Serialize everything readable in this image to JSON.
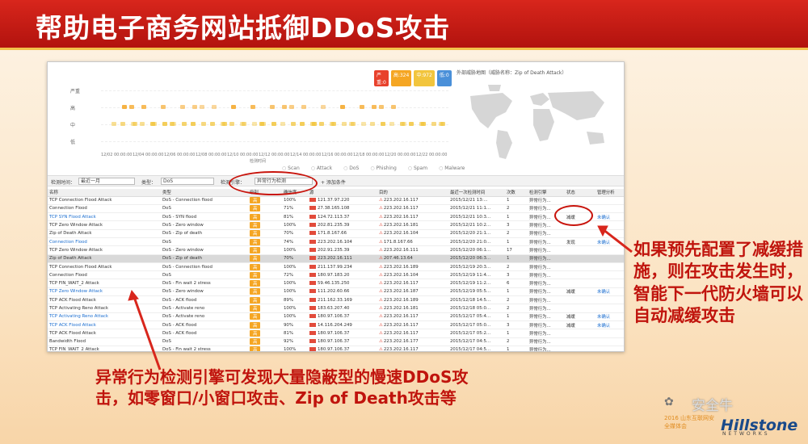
{
  "slide": {
    "title": "帮助电子商务网站抵御DDoS攻击",
    "callout_right": "如果预先配置了减缓措施，则在攻击发生时，智能下一代防火墙可以自动减缓攻击",
    "callout_left": "异常行为检测引擎可发现大量隐蔽型的慢速DDoS攻击，如零窗口/小窗口攻击、Zip of Death攻击等"
  },
  "chart": {
    "legend": [
      "严重:0",
      "高:324",
      "中:972",
      "低:0"
    ],
    "legend_colors": [
      "#e8412c",
      "#f5a623",
      "#f2c53d",
      "#4a90d9"
    ],
    "y_labels": [
      "严重",
      "高",
      "中",
      "低"
    ],
    "x_ticks": [
      "12/02 00:00:00",
      "12/04 00:00:00",
      "12/06 00:00:00",
      "12/08 00:00:00",
      "12/10 00:00:00",
      "12/12 00:00:00",
      "12/14 00:00:00",
      "12/16 00:00:00",
      "12/18 00:00:00",
      "12/20 00:00:00",
      "12/22 00:00:00"
    ],
    "x_label": "检测时间"
  },
  "map": {
    "title": "外部威胁地图（威胁名称：Zip of Death Attack）"
  },
  "categories": [
    "Scan",
    "Attack",
    "DoS",
    "Phishing",
    "Spam",
    "Malware"
  ],
  "filters": {
    "time_label": "检测时间：",
    "time_value": "最近一月",
    "type_label": "类型：",
    "type_value": "DoS",
    "engine_label": "检测引擎：",
    "engine_value": "异常行为检测",
    "add_label": "+  添加条件"
  },
  "table": {
    "headers": [
      "名称",
      "类型",
      "级别",
      "确信度",
      "源",
      "目的",
      "最近一次检测时间",
      "次数",
      "检测引擎",
      "状态",
      "管理分析"
    ],
    "rows": [
      {
        "name": "TCP Connection Flood Attack",
        "type": "DoS - Connection flood",
        "sev": "高",
        "conf": "100%",
        "src": "121.37.97.220",
        "dst": "223.202.16.117",
        "time": "2015/12/21 13:...",
        "count": "1",
        "engine": "异常行为...",
        "status": "",
        "action": ""
      },
      {
        "name": "Connection Flood",
        "type": "DoS",
        "sev": "高",
        "conf": "71%",
        "src": "27.38.165.108",
        "dst": "223.202.16.117",
        "time": "2015/12/21 11:1...",
        "count": "2",
        "engine": "异常行为...",
        "status": "",
        "action": ""
      },
      {
        "name": "TCP SYN Flood Attack",
        "type": "DoS - SYN flood",
        "sev": "高",
        "conf": "81%",
        "src": "124.72.113.37",
        "dst": "223.202.16.117",
        "time": "2015/12/21 10:3...",
        "count": "1",
        "engine": "异常行为...",
        "status": "减缓",
        "action": "未确认"
      },
      {
        "name": "TCP Zero Window Attack",
        "type": "DoS - Zero window",
        "sev": "高",
        "conf": "100%",
        "src": "202.81.235.39",
        "dst": "223.202.16.181",
        "time": "2015/12/21 10:2...",
        "count": "3",
        "engine": "异常行为...",
        "status": "",
        "action": ""
      },
      {
        "name": "Zip of Death Attack",
        "type": "DoS - Zip of death",
        "sev": "高",
        "conf": "70%",
        "src": "171.8.167.66",
        "dst": "223.202.16.104",
        "time": "2015/12/20 21:1...",
        "count": "2",
        "engine": "异常行为...",
        "status": "",
        "action": ""
      },
      {
        "name": "Connection Flood",
        "type": "DoS",
        "sev": "高",
        "conf": "74%",
        "src": "223.202.16.104",
        "dst": "171.8.167.66",
        "time": "2015/12/20 21:0...",
        "count": "1",
        "engine": "异常行为...",
        "status": "发现",
        "action": "未确认"
      },
      {
        "name": "TCP Zero Window Attack",
        "type": "DoS - Zero window",
        "sev": "高",
        "conf": "100%",
        "src": "202.91.235.39",
        "dst": "223.202.16.111",
        "time": "2015/12/20 06:1...",
        "count": "17",
        "engine": "异常行为...",
        "status": "",
        "action": ""
      },
      {
        "name": "Zip of Death Attack",
        "type": "DoS - Zip of death",
        "sev": "高",
        "conf": "70%",
        "src": "223.202.16.111",
        "dst": "207.46.13.64",
        "time": "2015/12/20 06:3...",
        "count": "1",
        "engine": "异常行为...",
        "status": "",
        "action": ""
      },
      {
        "name": "TCP Connection Flood Attack",
        "type": "DoS - Connection flood",
        "sev": "高",
        "conf": "100%",
        "src": "211.137.99.234",
        "dst": "223.202.16.189",
        "time": "2015/12/19 20:3...",
        "count": "2",
        "engine": "异常行为...",
        "status": "",
        "action": ""
      },
      {
        "name": "Connection Flood",
        "type": "DoS",
        "sev": "高",
        "conf": "72%",
        "src": "180.97.183.20",
        "dst": "223.202.16.104",
        "time": "2015/12/19 11:4...",
        "count": "3",
        "engine": "异常行为...",
        "status": "",
        "action": ""
      },
      {
        "name": "TCP FIN_WAIT_2 Attack",
        "type": "DoS - Fin wait 2 stress",
        "sev": "高",
        "conf": "100%",
        "src": "59.46.135.250",
        "dst": "223.202.16.117",
        "time": "2015/12/19 11:2...",
        "count": "6",
        "engine": "异常行为...",
        "status": "",
        "action": ""
      },
      {
        "name": "TCP Zero Window Attack",
        "type": "DoS - Zero window",
        "sev": "高",
        "conf": "100%",
        "src": "111.202.60.66",
        "dst": "223.202.16.187",
        "time": "2015/12/19 05:5...",
        "count": "1",
        "engine": "异常行为...",
        "status": "减缓",
        "action": "未确认"
      },
      {
        "name": "TCP ACK Flood Attack",
        "type": "DoS - ACK flood",
        "sev": "高",
        "conf": "89%",
        "src": "211.162.33.169",
        "dst": "223.202.16.189",
        "time": "2015/12/18 14:5...",
        "count": "2",
        "engine": "异常行为...",
        "status": "",
        "action": ""
      },
      {
        "name": "TCP Activating Reno Attack",
        "type": "DoS - Activate reno",
        "sev": "高",
        "conf": "100%",
        "src": "183.63.207.40",
        "dst": "223.202.16.181",
        "time": "2015/12/18 05:0...",
        "count": "2",
        "engine": "异常行为...",
        "status": "",
        "action": ""
      },
      {
        "name": "TCP Activating Reno Attack",
        "type": "DoS - Activate reno",
        "sev": "高",
        "conf": "100%",
        "src": "180.97.106.37",
        "dst": "223.202.16.117",
        "time": "2015/12/17 05:4...",
        "count": "1",
        "engine": "异常行为...",
        "status": "减缓",
        "action": "未确认"
      },
      {
        "name": "TCP ACK Flood Attack",
        "type": "DoS - ACK flood",
        "sev": "高",
        "conf": "90%",
        "src": "14.116.204.249",
        "dst": "223.202.16.117",
        "time": "2015/12/17 05:0...",
        "count": "3",
        "engine": "异常行为...",
        "status": "减缓",
        "action": "未确认"
      },
      {
        "name": "TCP ACK Flood Attack",
        "type": "DoS - ACK flood",
        "sev": "高",
        "conf": "81%",
        "src": "180.97.106.37",
        "dst": "223.202.16.117",
        "time": "2015/12/17 05:2...",
        "count": "1",
        "engine": "异常行为...",
        "status": "",
        "action": ""
      },
      {
        "name": "Bandwidth Flood",
        "type": "DoS",
        "sev": "高",
        "conf": "92%",
        "src": "180.97.106.37",
        "dst": "223.202.16.177",
        "time": "2015/12/17 04:5...",
        "count": "2",
        "engine": "异常行为...",
        "status": "",
        "action": ""
      },
      {
        "name": "TCP FIN_WAIT_2 Attack",
        "type": "DoS - Fin wait 2 stress",
        "sev": "高",
        "conf": "100%",
        "src": "180.97.106.37",
        "dst": "223.202.16.117",
        "time": "2015/12/17 04:5...",
        "count": "1",
        "engine": "异常行为...",
        "status": "",
        "action": ""
      }
    ]
  },
  "logo": {
    "wechat": "安全牛",
    "conference": "2016 山东互联网安全媒体会",
    "brand": "Hillstone",
    "networks": "NETWORKS"
  }
}
